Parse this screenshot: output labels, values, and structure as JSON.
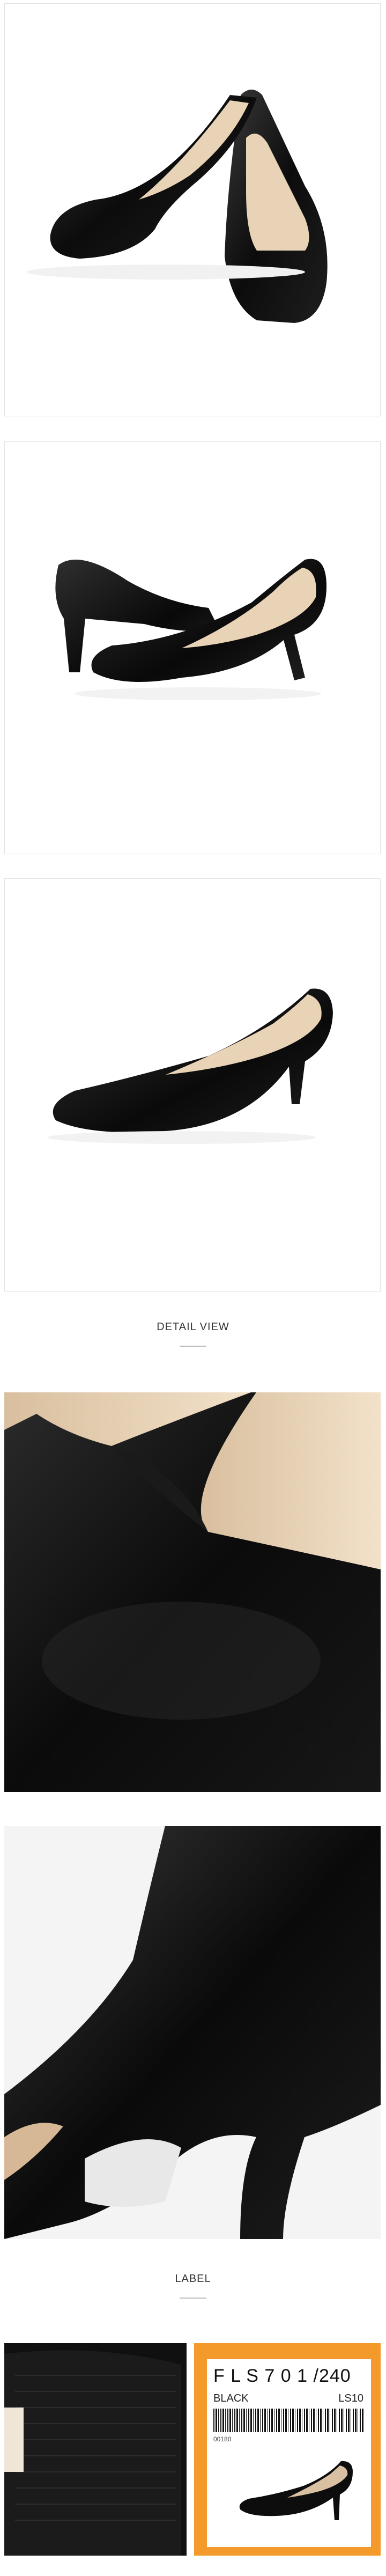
{
  "sections": {
    "detail_title": "DETAIL VIEW",
    "label_title": "LABEL"
  },
  "label_tag": {
    "code": "F L S 7 0 1 /240",
    "color": "BLACK",
    "size": "LS10",
    "small_number": "00180"
  },
  "colors": {
    "frame_border": "#e2e2e2",
    "shoe_black": "#0d0d0d",
    "lining_beige": "#e9d3b6",
    "tag_orange": "#f39a2b"
  }
}
